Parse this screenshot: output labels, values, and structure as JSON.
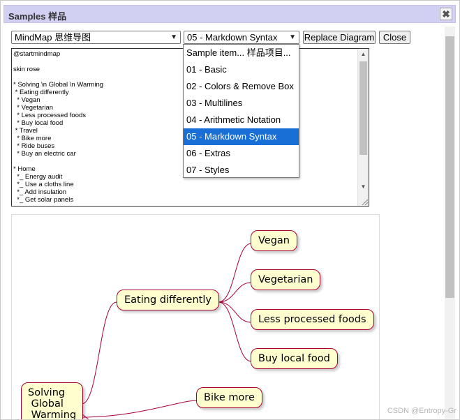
{
  "dialog": {
    "title": "Samples 样品",
    "close_icon": "✖"
  },
  "toolbar": {
    "type_select": "MindMap 思维导图",
    "sample_select": "05 - Markdown Syntax",
    "replace_label": "Replace Diagram",
    "close_label": "Close"
  },
  "editor": {
    "text": "@startmindmap\n\nskin rose\n\n* Solving \\n Global \\n Warming\n * Eating differently\n  * Vegan\n  * Vegetarian\n  * Less processed foods\n  * Buy local food\n * Travel\n  * Bike more\n  * Ride buses\n  * Buy an electric car\n\n* Home\n  *_ Energy audit\n  *_ Use a cloths line\n  *_ Add insulation\n  *_ Get solar panels"
  },
  "dropdown": {
    "options": [
      "Sample item... 样品项目...",
      "01 - Basic",
      "02 - Colors & Remove Box",
      "03 - Multilines",
      "04 - Arithmetic Notation",
      "05 - Markdown Syntax",
      "06 - Extras",
      "07 - Styles"
    ],
    "selected": "05 - Markdown Syntax"
  },
  "diagram": {
    "root": "Solving\n Global\n Warming",
    "branch1": "Eating differently",
    "leaves1": [
      "Vegan",
      "Vegetarian",
      "Less processed foods",
      "Buy local food"
    ],
    "branch2_leaf": "Bike more",
    "line_color": "#a80036",
    "node_fill": "#fefece"
  },
  "watermark": "CSDN @Entropy-Gr"
}
